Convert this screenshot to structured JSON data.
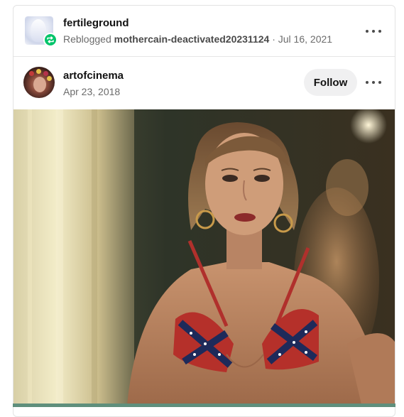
{
  "reblog": {
    "username": "fertileground",
    "reblogged_prefix": "Reblogged",
    "reblogged_from": "mothercain-deactivated20231124",
    "separator": "·",
    "date": "Jul 16, 2021"
  },
  "post": {
    "author": "artofcinema",
    "date": "Apr 23, 2018",
    "follow_label": "Follow"
  },
  "colors": {
    "reblog_badge": "#00c46a",
    "bottom_accent": "#5f8f7c"
  },
  "icons": {
    "more": "more-horizontal-icon",
    "reblog": "reblog-icon"
  }
}
